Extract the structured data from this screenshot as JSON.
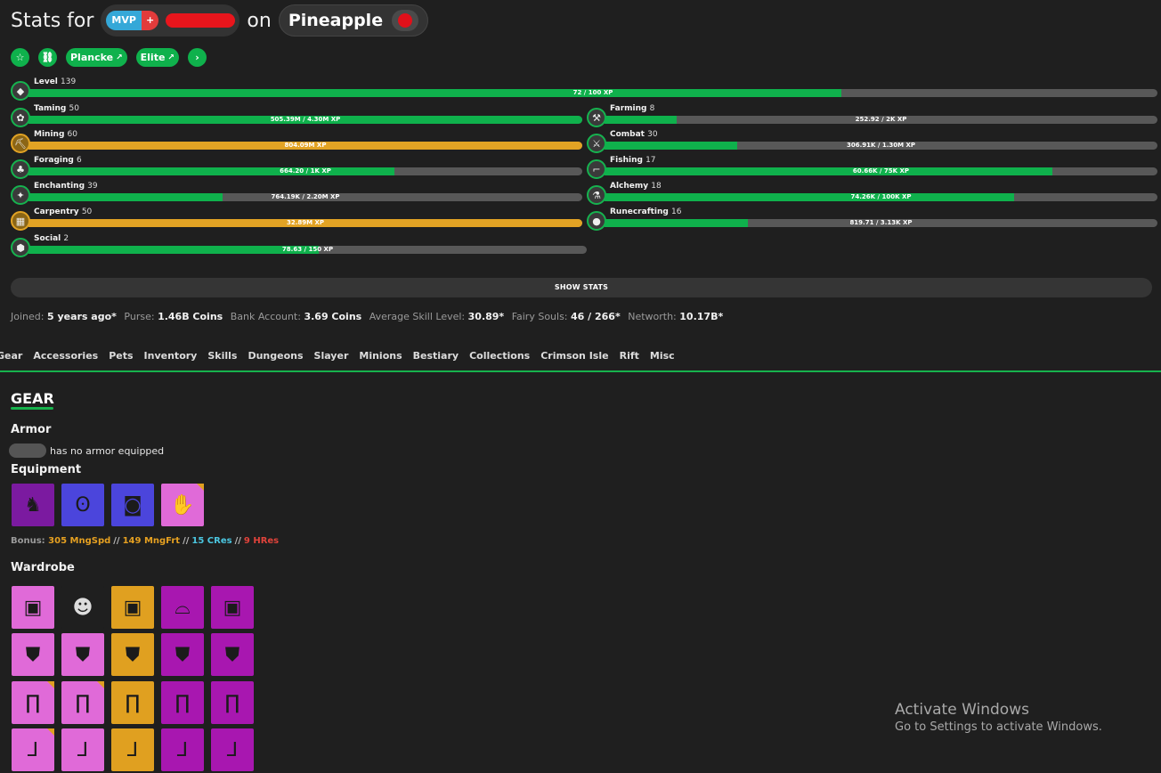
{
  "header": {
    "prefix": "Stats for",
    "rank_main": "MVP",
    "rank_plus": "+",
    "connector": "on",
    "profile_name": "Pineapple"
  },
  "links": {
    "plancke": "Plancke",
    "elite": "Elite"
  },
  "level": {
    "label": "Level",
    "value": "139",
    "xp": "72 / 100 XP",
    "progress": 0.72
  },
  "skills_left": [
    {
      "label": "Taming",
      "level": "50",
      "xp": "505.39M / 4.30M XP",
      "progress": 1.0,
      "maxed": false
    },
    {
      "label": "Mining",
      "level": "60",
      "xp": "804.09M XP",
      "progress": 1.0,
      "maxed": true
    },
    {
      "label": "Foraging",
      "level": "6",
      "xp": "664.20 / 1K XP",
      "progress": 0.66,
      "maxed": false
    },
    {
      "label": "Enchanting",
      "level": "39",
      "xp": "764.19K / 2.20M XP",
      "progress": 0.35,
      "maxed": false
    },
    {
      "label": "Carpentry",
      "level": "50",
      "xp": "32.89M XP",
      "progress": 1.0,
      "maxed": true
    },
    {
      "label": "Social",
      "level": "2",
      "xp": "78.63 / 150 XP",
      "progress": 0.52,
      "maxed": false
    }
  ],
  "skills_right": [
    {
      "label": "Farming",
      "level": "8",
      "xp": "252.92 / 2K XP",
      "progress": 0.13,
      "maxed": false
    },
    {
      "label": "Combat",
      "level": "30",
      "xp": "306.91K / 1.30M XP",
      "progress": 0.24,
      "maxed": false
    },
    {
      "label": "Fishing",
      "level": "17",
      "xp": "60.66K / 75K XP",
      "progress": 0.81,
      "maxed": false
    },
    {
      "label": "Alchemy",
      "level": "18",
      "xp": "74.26K / 100K XP",
      "progress": 0.74,
      "maxed": false
    },
    {
      "label": "Runecrafting",
      "level": "16",
      "xp": "819.71 / 3.13K XP",
      "progress": 0.26,
      "maxed": false
    }
  ],
  "show_stats": "SHOW STATS",
  "stats": {
    "joined_label": "Joined:",
    "joined": "5 years ago*",
    "purse_label": "Purse:",
    "purse": "1.46B Coins",
    "bank_label": "Bank Account:",
    "bank": "3.69 Coins",
    "avg_label": "Average Skill Level:",
    "avg": "30.89*",
    "souls_label": "Fairy Souls:",
    "souls": "46 / 266*",
    "networth_label": "Networth:",
    "networth": "10.17B*"
  },
  "tabs": [
    "Gear",
    "Accessories",
    "Pets",
    "Inventory",
    "Skills",
    "Dungeons",
    "Slayer",
    "Minions",
    "Bestiary",
    "Collections",
    "Crimson Isle",
    "Rift",
    "Misc"
  ],
  "gear": {
    "heading": "GEAR",
    "armor_heading": "Armor",
    "no_armor": "has no armor equipped",
    "equipment_heading": "Equipment",
    "bonus_label": "Bonus:",
    "bonus_1": "305 MngSpd",
    "bonus_2": "149 MngFrt",
    "bonus_3": "15 CRes",
    "bonus_4": "9 HRes",
    "sep": "//",
    "wardrobe_heading": "Wardrobe"
  },
  "colors": {
    "accent": "#0fb14c",
    "gold": "#e2a324",
    "background": "#1f1f1f"
  },
  "watermark": {
    "line1": "Activate Windows",
    "line2": "Go to Settings to activate Windows."
  }
}
